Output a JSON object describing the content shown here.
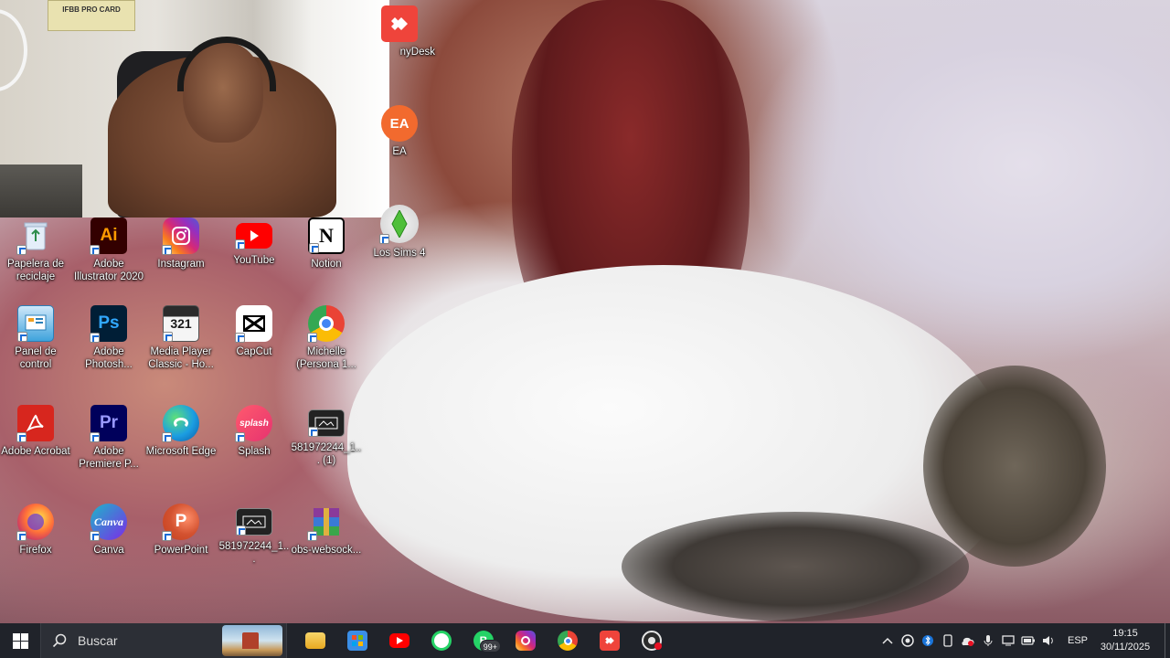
{
  "desktop": {
    "icons": [
      {
        "label": "nyDesk",
        "icon": "anydesk-icon",
        "color": "#ef443b"
      },
      {
        "label": "EA",
        "icon": "ea-icon",
        "color": "#f26a2e"
      },
      {
        "label": "Papelera de reciclaje",
        "icon": "recycle-bin-icon",
        "color": "#dfe9f5"
      },
      {
        "label": "Adobe Illustrator 2020",
        "icon": "illustrator-icon",
        "color": "#330000"
      },
      {
        "label": "Instagram",
        "icon": "instagram-icon",
        "color": "#d62976"
      },
      {
        "label": "YouTube",
        "icon": "youtube-icon",
        "color": "#ff0000"
      },
      {
        "label": "Notion",
        "icon": "notion-icon",
        "color": "#ffffff"
      },
      {
        "label": "Los Sims 4",
        "icon": "sims-4-icon",
        "color": "#4fbf3a"
      },
      {
        "label": "Panel de control",
        "icon": "control-panel-icon",
        "color": "#3fa3dc"
      },
      {
        "label": "Adobe Photosh...",
        "icon": "photoshop-icon",
        "color": "#001e36"
      },
      {
        "label": "Media Player Classic - Ho...",
        "icon": "media-player-classic-icon",
        "color": "#2b2b2b"
      },
      {
        "label": "CapCut",
        "icon": "capcut-icon",
        "color": "#ffffff"
      },
      {
        "label": "Michelle (Persona 1...",
        "icon": "chrome-profile-icon",
        "color": "#4285f4"
      },
      {
        "label": "Adobe Acrobat",
        "icon": "acrobat-icon",
        "color": "#d7261e"
      },
      {
        "label": "Adobe Premiere P...",
        "icon": "premiere-icon",
        "color": "#00005b"
      },
      {
        "label": "Microsoft Edge",
        "icon": "edge-icon",
        "color": "#1b9de2"
      },
      {
        "label": "Splash",
        "icon": "splash-icon",
        "color": "#e6336f"
      },
      {
        "label": "581972244_1... (1)",
        "icon": "image-file-icon",
        "color": "#222222"
      },
      {
        "label": "Firefox",
        "icon": "firefox-icon",
        "color": "#ff7139"
      },
      {
        "label": "Canva",
        "icon": "canva-icon",
        "color": "#1cb7c9"
      },
      {
        "label": "PowerPoint",
        "icon": "powerpoint-icon",
        "color": "#c43e1c"
      },
      {
        "label": "581972244_1...",
        "icon": "image-file-icon",
        "color": "#222222"
      },
      {
        "label": "obs-websock...",
        "icon": "winrar-archive-icon",
        "color": "#8a3a9a"
      }
    ],
    "webcam": {
      "card_text": "IFBB PRO CARD"
    }
  },
  "taskbar": {
    "search_placeholder": "Buscar",
    "apps": [
      {
        "name": "file-explorer",
        "icon": "folder-icon",
        "color": "#f3c443"
      },
      {
        "name": "microsoft-store",
        "icon": "store-icon",
        "color": "#3a8ee6"
      },
      {
        "name": "youtube",
        "icon": "youtube-icon",
        "color": "#ff0000"
      },
      {
        "name": "whatsapp",
        "icon": "whatsapp-icon",
        "color": "#25d366"
      },
      {
        "name": "whatsapp-business",
        "icon": "whatsapp-business-icon",
        "color": "#25d366",
        "badge": "99+"
      },
      {
        "name": "instagram",
        "icon": "instagram-icon",
        "color": "#d62976"
      },
      {
        "name": "chrome",
        "icon": "chrome-icon",
        "color": "#4285f4"
      },
      {
        "name": "anydesk",
        "icon": "anydesk-icon",
        "color": "#ef443b"
      },
      {
        "name": "obs-studio",
        "icon": "obs-icon",
        "color": "#2b2b2b"
      }
    ],
    "tray": {
      "language": "ESP",
      "time": "19:15",
      "date": "30/11/2025"
    }
  }
}
